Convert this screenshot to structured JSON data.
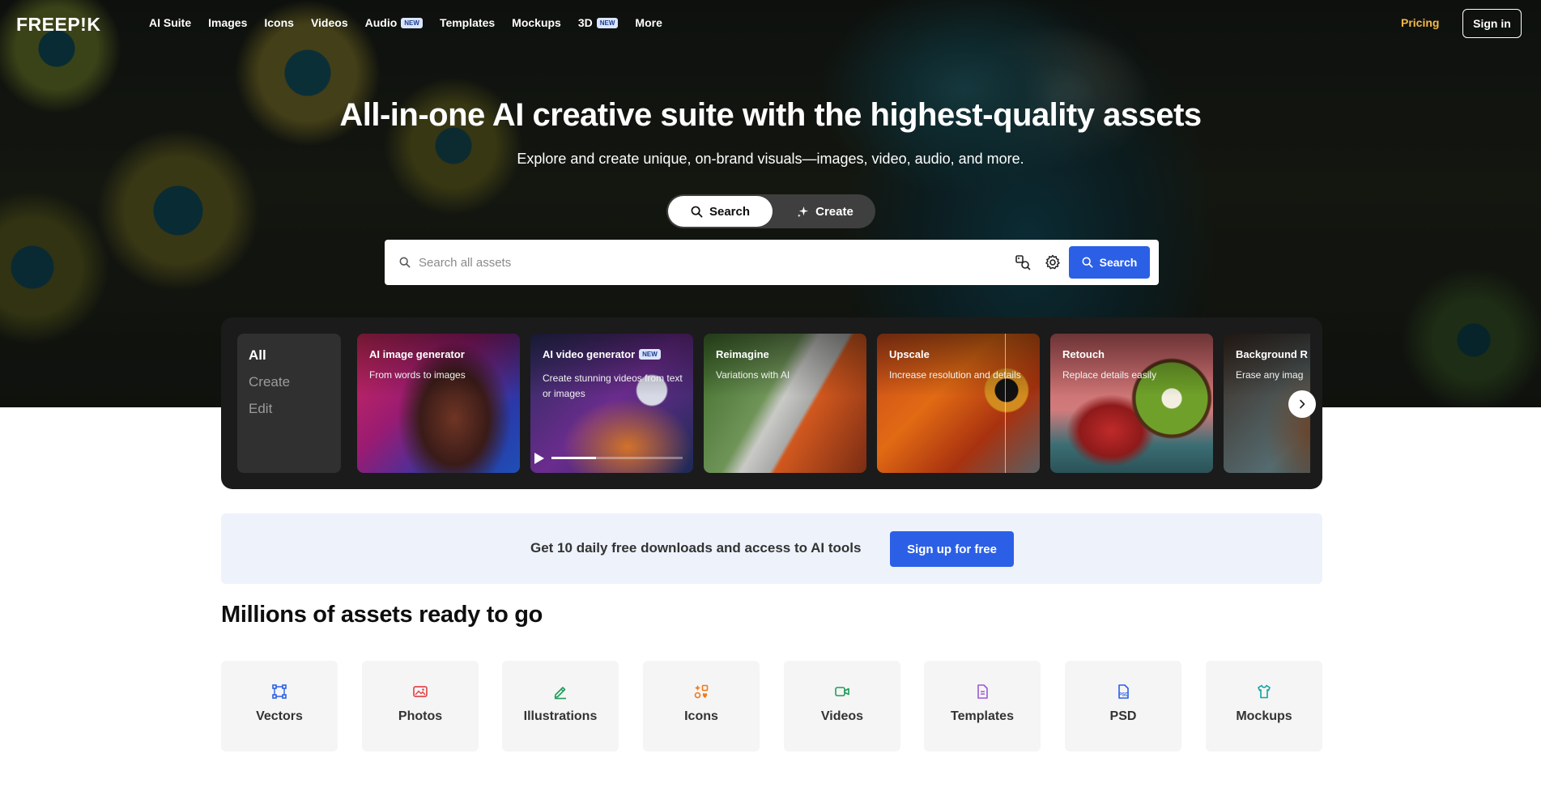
{
  "brand": {
    "logo_text": "FREEP!K"
  },
  "nav": {
    "items": [
      {
        "label": "AI Suite",
        "badge": ""
      },
      {
        "label": "Images",
        "badge": ""
      },
      {
        "label": "Icons",
        "badge": ""
      },
      {
        "label": "Videos",
        "badge": ""
      },
      {
        "label": "Audio",
        "badge": "NEW"
      },
      {
        "label": "Templates",
        "badge": ""
      },
      {
        "label": "Mockups",
        "badge": ""
      },
      {
        "label": "3D",
        "badge": "NEW"
      },
      {
        "label": "More",
        "badge": ""
      }
    ],
    "pricing_label": "Pricing",
    "signin_label": "Sign in"
  },
  "hero": {
    "title": "All-in-one AI creative suite with the highest-quality assets",
    "subtitle": "Explore and create unique, on-brand visuals—images, video, audio, and more.",
    "mode_toggle": {
      "search_label": "Search",
      "create_label": "Create",
      "active": "Search"
    },
    "search": {
      "placeholder": "Search all assets",
      "button_label": "Search"
    }
  },
  "tools_panel": {
    "tabs": [
      {
        "label": "All",
        "active": true
      },
      {
        "label": "Create",
        "active": false
      },
      {
        "label": "Edit",
        "active": false
      }
    ],
    "cards": [
      {
        "title": "AI image generator",
        "subtitle": "From words to images",
        "badge": ""
      },
      {
        "title": "AI video generator",
        "subtitle": "Create stunning videos from text or images",
        "badge": "NEW",
        "video_progress": 0.34
      },
      {
        "title": "Reimagine",
        "subtitle": "Variations with AI",
        "badge": ""
      },
      {
        "title": "Upscale",
        "subtitle": "Increase resolution and details",
        "badge": ""
      },
      {
        "title": "Retouch",
        "subtitle": "Replace details easily",
        "badge": ""
      },
      {
        "title": "Background R",
        "subtitle": "Erase any imag",
        "badge": ""
      }
    ]
  },
  "promo": {
    "text": "Get 10 daily free downloads and access to AI tools",
    "button_label": "Sign up for free"
  },
  "categories": {
    "title": "Millions of assets ready to go",
    "items": [
      {
        "label": "Vectors",
        "icon": "vector-nodes-icon",
        "color": "#2b60e6"
      },
      {
        "label": "Photos",
        "icon": "photo-icon",
        "color": "#e5484d"
      },
      {
        "label": "Illustrations",
        "icon": "illustration-pen-icon",
        "color": "#1f9c5a"
      },
      {
        "label": "Icons",
        "icon": "icons-grid-icon",
        "color": "#f07a1a"
      },
      {
        "label": "Videos",
        "icon": "video-camera-icon",
        "color": "#1f9c5a"
      },
      {
        "label": "Templates",
        "icon": "template-doc-icon",
        "color": "#9b59d6"
      },
      {
        "label": "PSD",
        "icon": "psd-file-icon",
        "color": "#2b60e6"
      },
      {
        "label": "Mockups",
        "icon": "mockup-shirt-icon",
        "color": "#17a2a2"
      }
    ]
  },
  "colors": {
    "accent": "#2b60e6",
    "pricing": "#f6b84a",
    "panel": "#1b1b1b",
    "promo_bg": "#eef2fb"
  }
}
